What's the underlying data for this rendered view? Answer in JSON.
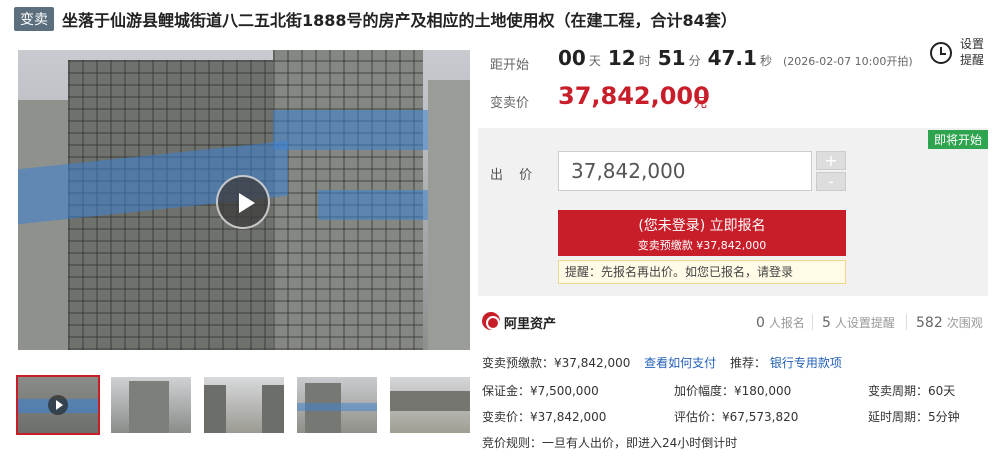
{
  "header": {
    "tag": "变卖",
    "title": "坐落于仙游县鲤城街道八二五北街1888号的房产及相应的土地使用权（在建工程，合计84套）"
  },
  "countdown": {
    "label": "距开始",
    "days": "00",
    "days_unit": "天",
    "hours": "12",
    "hours_unit": "时",
    "minutes": "51",
    "minutes_unit": "分",
    "seconds": "47.1",
    "seconds_unit": "秒",
    "start_note": "(2026-02-07 10:00开拍)"
  },
  "remind": {
    "label": "设置提醒",
    "icon": "alarm-clock-icon"
  },
  "price": {
    "label": "变卖价",
    "value": "37,842,000",
    "unit": "元",
    "color": "#c81e2a"
  },
  "bid": {
    "status": "即将开始",
    "label": "出 价",
    "input_value": "37,842,000",
    "plus": "+",
    "minus": "-",
    "signup_line1": "(您未登录) 立即报名",
    "signup_line2": "变卖预缴款 ¥37,842,000",
    "tip": "提醒：先报名再出价。如您已报名，请登录"
  },
  "stats": {
    "platform": "阿里资产",
    "signups": "0",
    "signups_label": "人报名",
    "reminders": "5",
    "reminders_label": "人设置提醒",
    "views": "582",
    "views_label": "次围观"
  },
  "info": {
    "prepay_label": "变卖预缴款：¥37,842,000",
    "how_to_pay": "查看如何支付",
    "recommend_label": "推荐：",
    "bank_item": "银行专用款项",
    "deposit": "保证金：¥7,500,000",
    "increment": "加价幅度：¥180,000",
    "period": "变卖周期：60天",
    "sale_price": "变卖价：¥37,842,000",
    "appraisal": "评估价：¥67,573,820",
    "delay": "延时周期：5分钟",
    "rule": "竞价规则：一旦有人出价，即进入24小时倒计时"
  }
}
